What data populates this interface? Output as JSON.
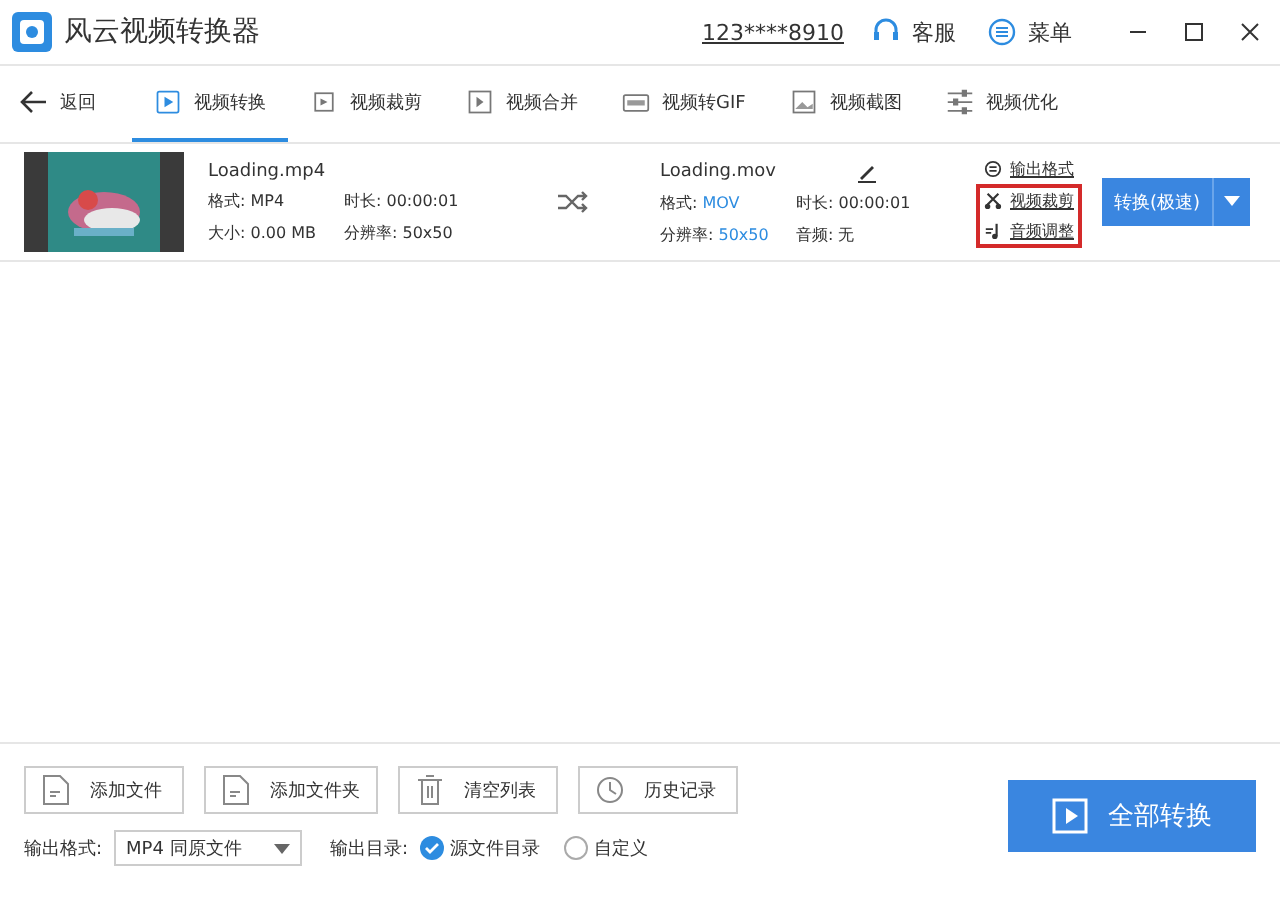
{
  "window": {
    "title": "风云视频转换器",
    "account": "123****8910",
    "support": "客服",
    "menu": "菜单"
  },
  "nav": {
    "back": "返回",
    "tabs": [
      {
        "label": "视频转换",
        "selected": true
      },
      {
        "label": "视频裁剪",
        "selected": false
      },
      {
        "label": "视频合并",
        "selected": false
      },
      {
        "label": "视频转GIF",
        "selected": false
      },
      {
        "label": "视频截图",
        "selected": false
      },
      {
        "label": "视频优化",
        "selected": false
      }
    ]
  },
  "file": {
    "kind": "picture",
    "source": {
      "name": "Loading.mp4",
      "format_label": "格式:",
      "format": "MP4",
      "duration_label": "时长:",
      "duration": "00:00:01",
      "size_label": "大小:",
      "size": "0.00 MB",
      "resolution_label": "分辨率:",
      "resolution": "50x50"
    },
    "output": {
      "name": "Loading.mov",
      "format_label": "格式:",
      "format": "MOV",
      "duration_label": "时长:",
      "duration": "00:00:01",
      "resolution_label": "分辨率:",
      "resolution": "50x50",
      "audio_label": "音频:",
      "audio": "无"
    },
    "actions": [
      {
        "label": "输出格式",
        "highlighted": false
      },
      {
        "label": "视频裁剪",
        "highlighted": true
      },
      {
        "label": "音频调整",
        "highlighted": true
      }
    ],
    "convert_button": "转换(极速)"
  },
  "bottom": {
    "buttons": [
      "添加文件",
      "添加文件夹",
      "清空列表",
      "历史记录"
    ],
    "format_label": "输出格式:",
    "format_value": "MP4 同原文件",
    "dir_label": "输出目录:",
    "dir_options": [
      {
        "label": "源文件目录",
        "selected": true
      },
      {
        "label": "自定义",
        "selected": false
      }
    ],
    "convert_all": "全部转换"
  }
}
